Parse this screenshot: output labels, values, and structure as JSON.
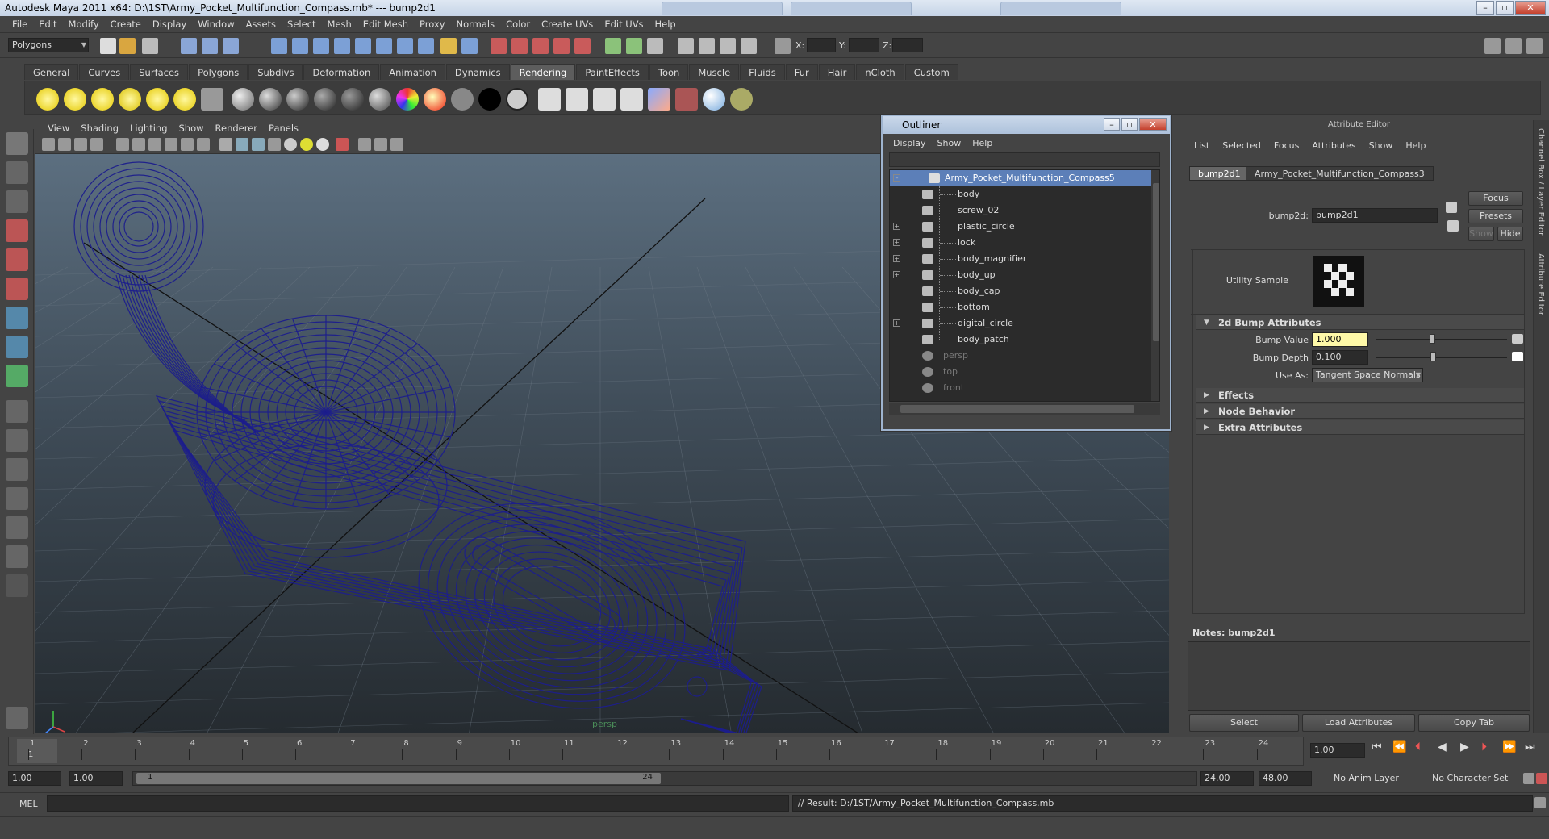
{
  "window": {
    "title": "Autodesk Maya 2011 x64: D:\\1ST\\Army_Pocket_Multifunction_Compass.mb*   ---   bump2d1"
  },
  "menubar": [
    "File",
    "Edit",
    "Modify",
    "Create",
    "Display",
    "Window",
    "Assets",
    "Select",
    "Mesh",
    "Edit Mesh",
    "Proxy",
    "Normals",
    "Color",
    "Create UVs",
    "Edit UVs",
    "Help"
  ],
  "statusline": {
    "mode": "Polygons",
    "x_label": "X:",
    "y_label": "Y:",
    "z_label": "Z:"
  },
  "shelf_tabs": [
    {
      "label": "General"
    },
    {
      "label": "Curves"
    },
    {
      "label": "Surfaces"
    },
    {
      "label": "Polygons"
    },
    {
      "label": "Subdivs"
    },
    {
      "label": "Deformation"
    },
    {
      "label": "Animation"
    },
    {
      "label": "Dynamics"
    },
    {
      "label": "Rendering",
      "active": true
    },
    {
      "label": "PaintEffects"
    },
    {
      "label": "Toon"
    },
    {
      "label": "Muscle"
    },
    {
      "label": "Fluids"
    },
    {
      "label": "Fur"
    },
    {
      "label": "Hair"
    },
    {
      "label": "nCloth"
    },
    {
      "label": "Custom"
    }
  ],
  "viewport": {
    "menu": [
      "View",
      "Shading",
      "Lighting",
      "Show",
      "Renderer",
      "Panels"
    ],
    "camera_label": "persp",
    "wire_color": "#1c1e8c"
  },
  "outliner": {
    "title": "Outliner",
    "menu": [
      "Display",
      "Show",
      "Help"
    ],
    "root": "Army_Pocket_Multifunction_Compass5",
    "children": [
      {
        "label": "body",
        "expandable": false
      },
      {
        "label": "screw_02",
        "expandable": false
      },
      {
        "label": "plastic_circle",
        "expandable": true
      },
      {
        "label": "lock",
        "expandable": true
      },
      {
        "label": "body_magnifier",
        "expandable": true
      },
      {
        "label": "body_up",
        "expandable": true
      },
      {
        "label": "body_cap",
        "expandable": false
      },
      {
        "label": "bottom",
        "expandable": false
      },
      {
        "label": "digital_circle",
        "expandable": true
      },
      {
        "label": "body_patch",
        "expandable": false
      }
    ],
    "cameras": [
      "persp",
      "top",
      "front"
    ]
  },
  "attribute_editor": {
    "title": "Attribute Editor",
    "menu": [
      "List",
      "Selected",
      "Focus",
      "Attributes",
      "Show",
      "Help"
    ],
    "tabs": [
      "bump2d1",
      "Army_Pocket_Multifunction_Compass3"
    ],
    "node_label": "bump2d:",
    "node_value": "bump2d1",
    "focus": "Focus",
    "presets": "Presets",
    "show": "Show",
    "hide": "Hide",
    "utility_sample": "Utility Sample",
    "sections": {
      "bump": "2d Bump Attributes",
      "effects": "Effects",
      "node_behavior": "Node Behavior",
      "extra": "Extra Attributes"
    },
    "bump_value_label": "Bump Value",
    "bump_value": "1.000",
    "bump_depth_label": "Bump Depth",
    "bump_depth": "0.100",
    "use_as_label": "Use As:",
    "use_as": "Tangent Space Normals",
    "notes_label": "Notes:  bump2d1",
    "buttons": {
      "select": "Select",
      "load": "Load Attributes",
      "copy": "Copy Tab"
    }
  },
  "side_strip": [
    "Channel Box / Layer Editor",
    "Attribute Editor"
  ],
  "timeline": {
    "ticks": [
      "1",
      "2",
      "3",
      "4",
      "5",
      "6",
      "7",
      "8",
      "9",
      "10",
      "11",
      "12",
      "13",
      "14",
      "15",
      "16",
      "17",
      "18",
      "19",
      "20",
      "21",
      "22",
      "23",
      "24"
    ],
    "current_frame": "1",
    "current_time": "1.00"
  },
  "range": {
    "start": "1.00",
    "start2": "1.00",
    "slider_start": "1",
    "slider_end": "24",
    "end": "24.00",
    "end2": "48.00",
    "anim_layer": "No Anim Layer",
    "char_set": "No Character Set"
  },
  "command": {
    "label": "MEL",
    "result": "// Result: D:/1ST/Army_Pocket_Multifunction_Compass.mb"
  }
}
